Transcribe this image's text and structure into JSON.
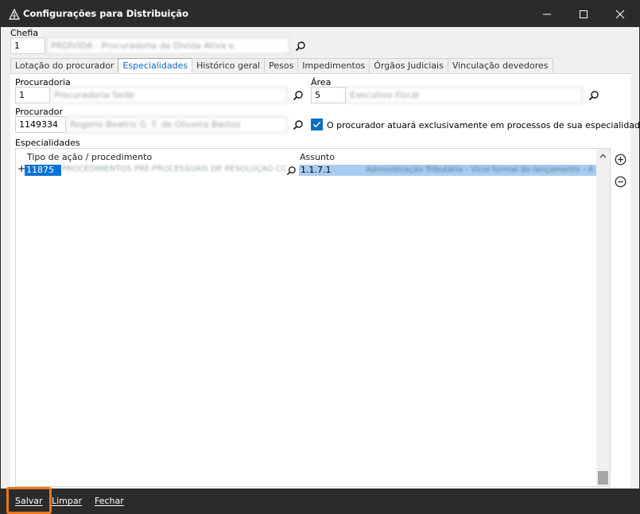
{
  "window": {
    "title": "Configurações para Distribuição",
    "icon": "app-triangle-icon"
  },
  "chefia": {
    "label": "Chefia",
    "code": "1",
    "name": "PRDÍVIDA - Procuradoria da Dívida Ativa e"
  },
  "tabs": [
    {
      "label": "Lotação do procurador",
      "active": false
    },
    {
      "label": "Especialidades",
      "active": true
    },
    {
      "label": "Histórico geral",
      "active": false
    },
    {
      "label": "Pesos",
      "active": false
    },
    {
      "label": "Impedimentos",
      "active": false
    },
    {
      "label": "Órgãos Judiciais",
      "active": false
    },
    {
      "label": "Vinculação devedores",
      "active": false
    }
  ],
  "procuradoria": {
    "label": "Procuradoria",
    "code": "1",
    "name": "Procuradoria Sede"
  },
  "area": {
    "label": "Área",
    "code": "5",
    "name": "Executivo Fiscal"
  },
  "procurador": {
    "label": "Procurador",
    "code": "1149334",
    "name": "Rogerio Beatriz G. F. de Oliveira Bastos"
  },
  "exclusive_checkbox": {
    "label": "O procurador atuará exclusivamente em processos de sua especialidade",
    "checked": true
  },
  "especialidades": {
    "label": "Especialidades",
    "columns": [
      "Tipo de ação / procedimento",
      "Assunto"
    ],
    "rows": [
      {
        "expander": "+",
        "code": "11875",
        "description": "PROCEDIMENTOS PRÉ-PROCESSUAIS DE RESOLUÇÃO CONSENSUAL",
        "subject_code": "1.1.7.1",
        "subject_desc": "Administração Tributária - Vício formal do lançamento - A"
      }
    ]
  },
  "buttons": {
    "save": "Salvar",
    "clear": "Limpar",
    "close": "Fechar"
  },
  "colors": {
    "titlebar": "#2b2b2b",
    "accent": "#0a72d6",
    "highlight_border": "#e8781e"
  }
}
